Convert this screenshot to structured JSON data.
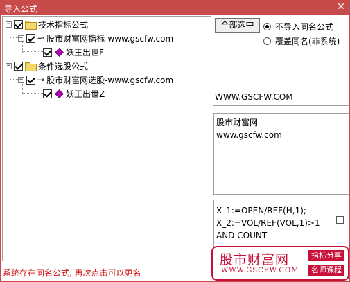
{
  "window": {
    "title": "导入公式",
    "close_glyph": "✕"
  },
  "tree": {
    "nodes": [
      {
        "label": "技术指标公式",
        "expander": "−",
        "checked": true
      },
      {
        "label": "股市财富网指标-www.gscfw.com",
        "expander": "−",
        "checked": true
      },
      {
        "label": "妖王出世F",
        "checked": true
      },
      {
        "label": "条件选股公式",
        "expander": "−",
        "checked": true
      },
      {
        "label": "股市财富网选股-www.gscfw.com",
        "expander": "−",
        "checked": true
      },
      {
        "label": "妖王出世Z",
        "checked": true
      }
    ]
  },
  "options": {
    "select_all_label": "全部选中",
    "radio_skip_label": "不导入同名公式",
    "radio_overwrite_label": "覆盖同名(非系统)",
    "selected": "skip"
  },
  "info": {
    "url": "WWW.GSCFW.COM",
    "description_lines": [
      "股市财富网",
      "www.gscfw.com"
    ],
    "code_lines": [
      "X_1:=OPEN/REF(H,1);",
      "X_2:=VOL/REF(VOL,1)>1",
      "AND COUNT"
    ]
  },
  "status": {
    "message": "系统存在同名公式, 再次点击可以更名"
  },
  "watermark": {
    "name": "股市财富网",
    "url": "WWW.GSCFW.COM",
    "tag1": "指标分享",
    "tag2": "名师课程"
  },
  "colors": {
    "titlebar": "#c84b4b",
    "status_text": "#d01010",
    "watermark": "#c8103a"
  }
}
